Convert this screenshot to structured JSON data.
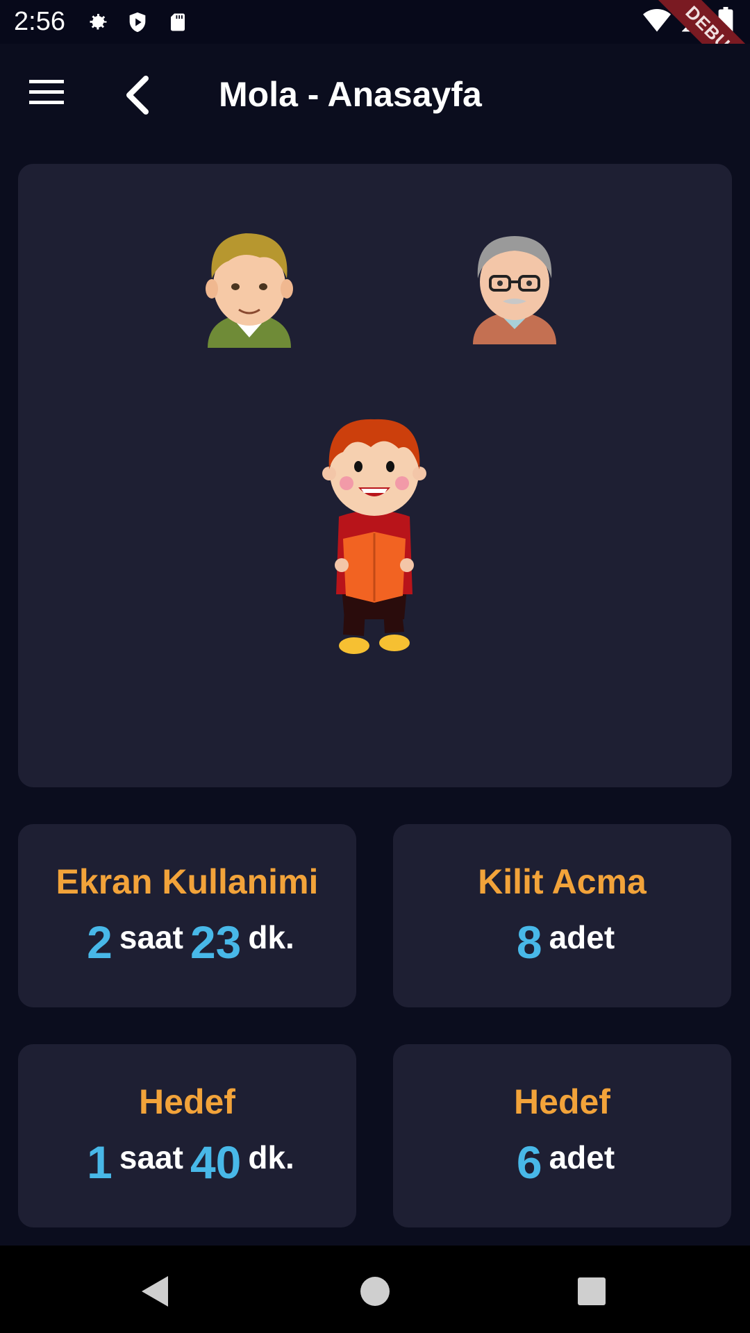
{
  "status_bar": {
    "time": "2:56",
    "icons": [
      "gear-icon",
      "shield-play-icon",
      "sd-card-icon",
      "wifi-icon",
      "signal-icon",
      "battery-icon"
    ]
  },
  "debug_banner": {
    "label": "DEBUG"
  },
  "app_bar": {
    "title": "Mola - Anasayfa",
    "menu_icon": "hamburger-menu-icon",
    "back_icon": "back-arrow-icon"
  },
  "hero": {
    "avatars": [
      "young-man-avatar",
      "old-man-avatar",
      "child-reading-avatar"
    ]
  },
  "stats": [
    {
      "title": "Ekran Kullanimi",
      "hours": "2",
      "hours_unit": "saat",
      "minutes": "23",
      "minutes_unit": "dk."
    },
    {
      "title": "Kilit Acma",
      "count": "8",
      "count_unit": "adet"
    },
    {
      "title": "Hedef",
      "hours": "1",
      "hours_unit": "saat",
      "minutes": "40",
      "minutes_unit": "dk."
    },
    {
      "title": "Hedef",
      "count": "6",
      "count_unit": "adet"
    }
  ],
  "nav_bar": {
    "icons": [
      "back-triangle-icon",
      "home-circle-icon",
      "recents-square-icon"
    ]
  },
  "colors": {
    "background": "#0b0d1e",
    "card": "#1e1f33",
    "accent_orange": "#f2a33a",
    "accent_blue": "#48b8e8"
  }
}
